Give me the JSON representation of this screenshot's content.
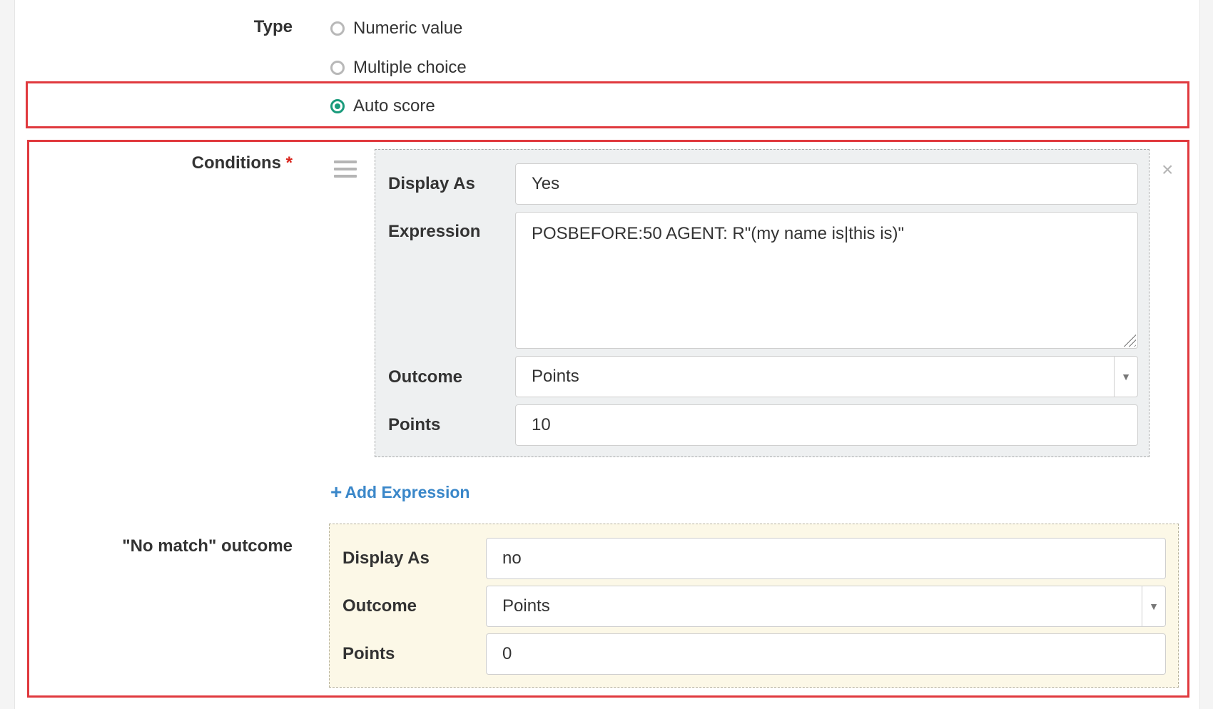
{
  "type_section": {
    "label": "Type",
    "options": [
      {
        "label": "Numeric value",
        "checked": false
      },
      {
        "label": "Multiple choice",
        "checked": false
      },
      {
        "label": "Auto score",
        "checked": true
      }
    ]
  },
  "conditions": {
    "label": "Conditions",
    "required_mark": "*",
    "item": {
      "display_as_label": "Display As",
      "display_as_value": "Yes",
      "expression_label": "Expression",
      "expression_value": "POSBEFORE:50 AGENT: R\"(my name is|this is)\"",
      "outcome_label": "Outcome",
      "outcome_value": "Points",
      "points_label": "Points",
      "points_value": "10"
    },
    "remove_icon": "close-icon",
    "drag_icon": "drag-handle-icon",
    "add_expression_label": "Add Expression"
  },
  "no_match": {
    "label": "\"No match\" outcome",
    "display_as_label": "Display As",
    "display_as_value": "no",
    "outcome_label": "Outcome",
    "outcome_value": "Points",
    "points_label": "Points",
    "points_value": "0"
  },
  "colors": {
    "accent": "#1a9b7c",
    "highlight": "#e0393e",
    "link": "#3a87c9",
    "required": "#d9251d"
  }
}
